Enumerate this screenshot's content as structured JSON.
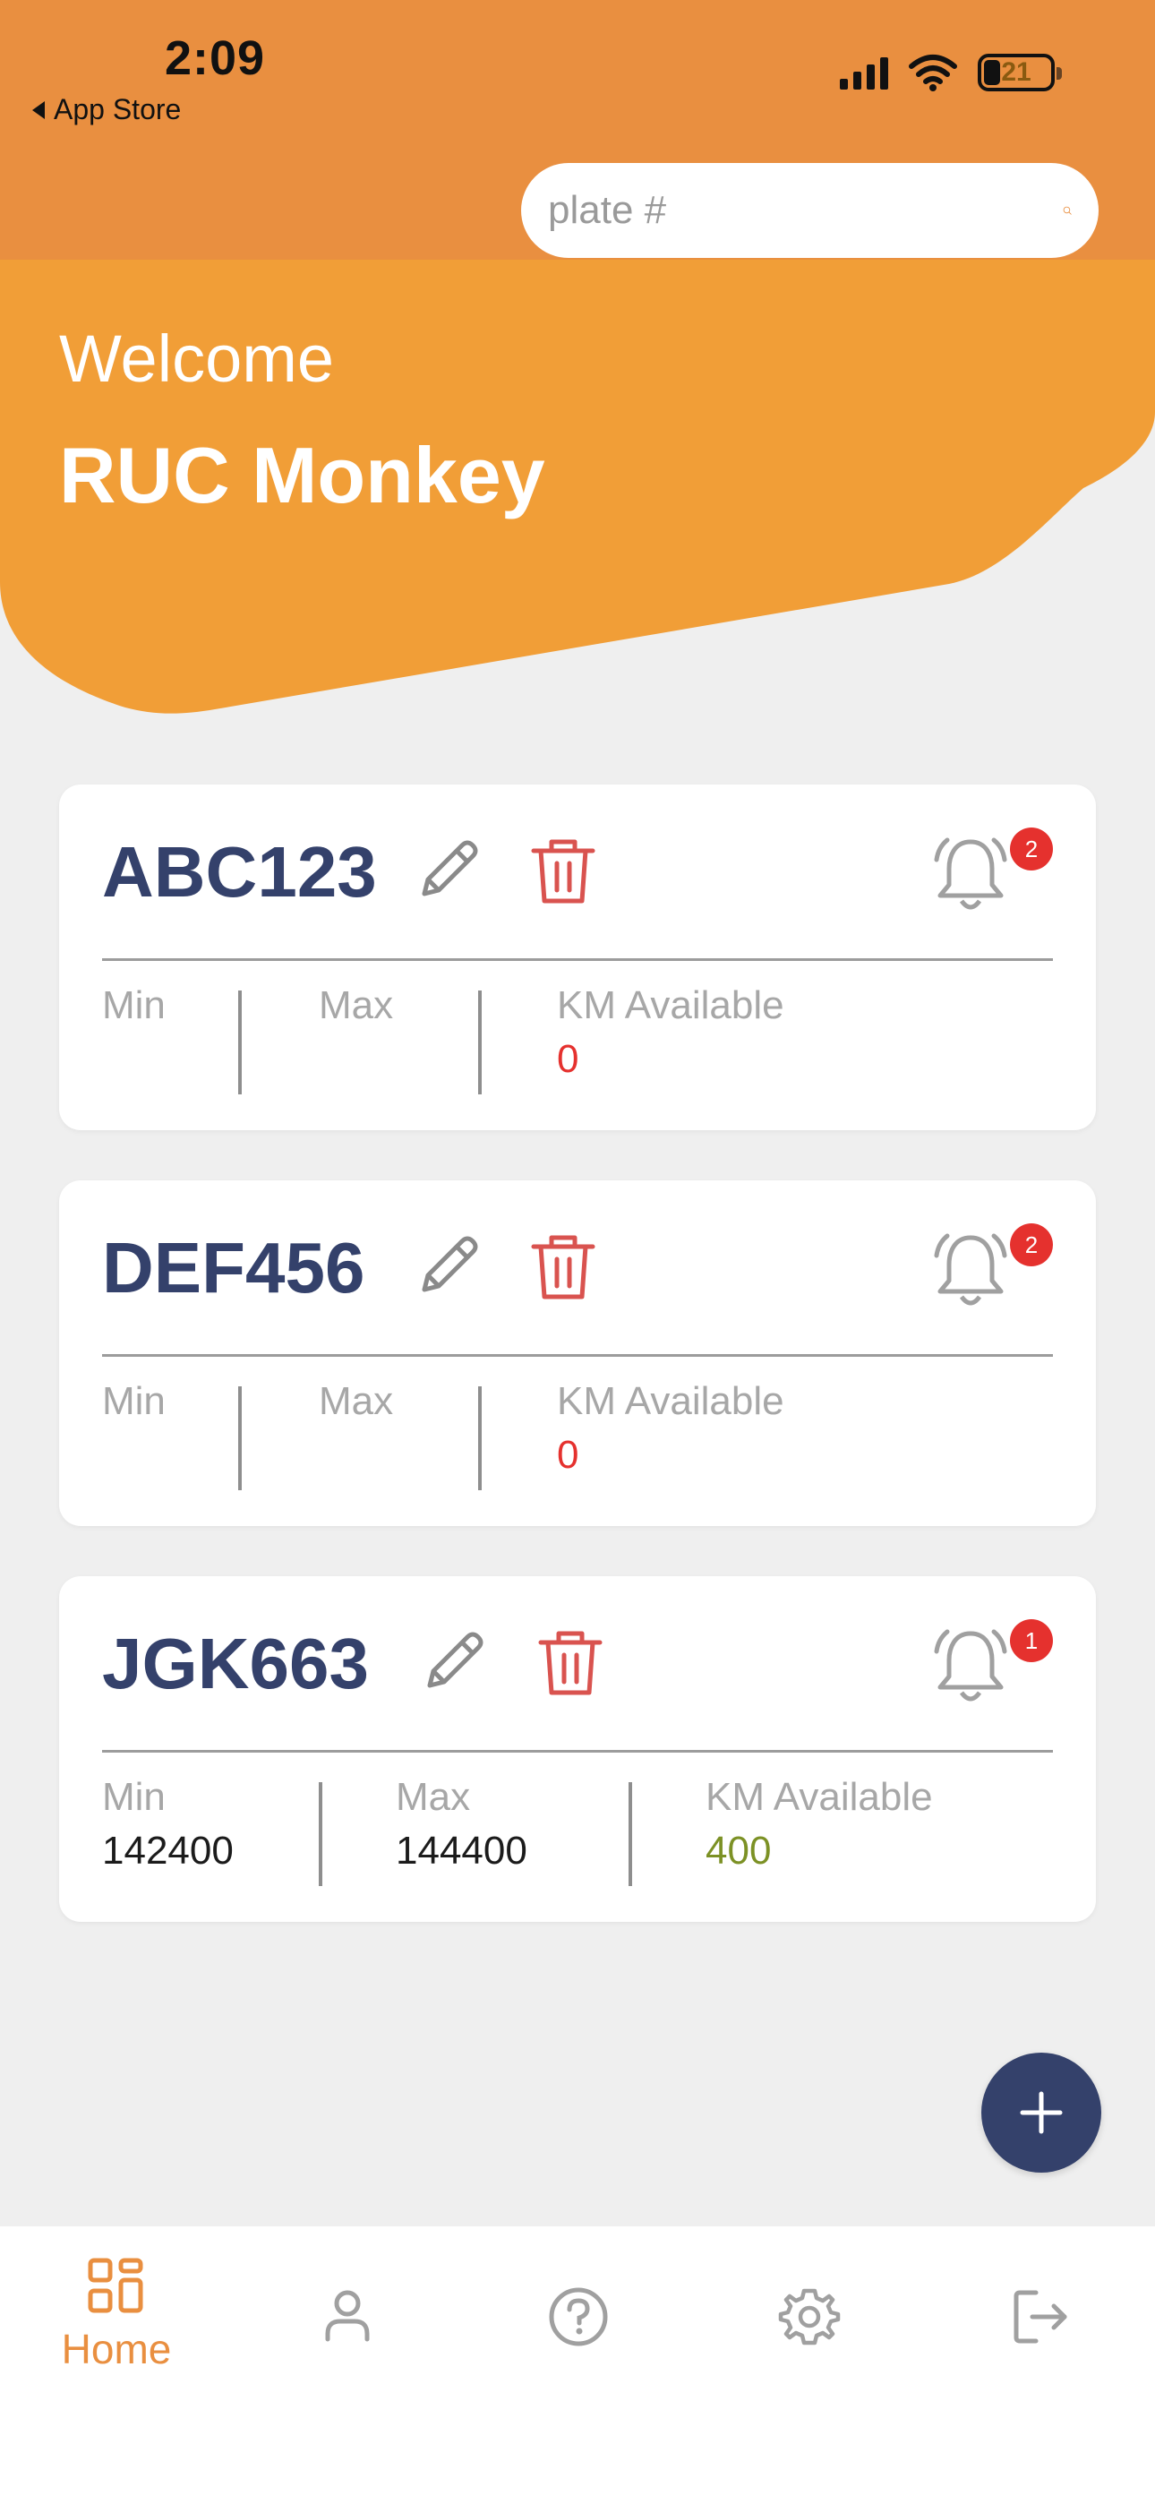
{
  "status_bar": {
    "time": "2:09",
    "back_label": "App Store",
    "battery": "21"
  },
  "search": {
    "placeholder": "plate #"
  },
  "header": {
    "welcome": "Welcome",
    "name": "RUC Monkey"
  },
  "stat_labels": {
    "min": "Min",
    "max": "Max",
    "km": "KM Available"
  },
  "vehicles": [
    {
      "plate": "ABC123",
      "alerts": "2",
      "min": "",
      "max": "",
      "km_available": "0"
    },
    {
      "plate": "DEF456",
      "alerts": "2",
      "min": "",
      "max": "",
      "km_available": "0"
    },
    {
      "plate": "JGK663",
      "alerts": "1",
      "min": "142400",
      "max": "144400",
      "km_available": "400"
    }
  ],
  "tabs": [
    {
      "label": "Home",
      "icon": "grid-icon",
      "active": true
    },
    {
      "label": "",
      "icon": "person-icon"
    },
    {
      "label": "",
      "icon": "help-icon"
    },
    {
      "label": "",
      "icon": "gear-icon"
    },
    {
      "label": "",
      "icon": "logout-icon"
    }
  ],
  "colors": {
    "orange": "#e98f40",
    "hero_orange": "#f19e37",
    "navy": "#34416b",
    "alert_red": "#e5312e",
    "positive_green": "#7c9125"
  }
}
